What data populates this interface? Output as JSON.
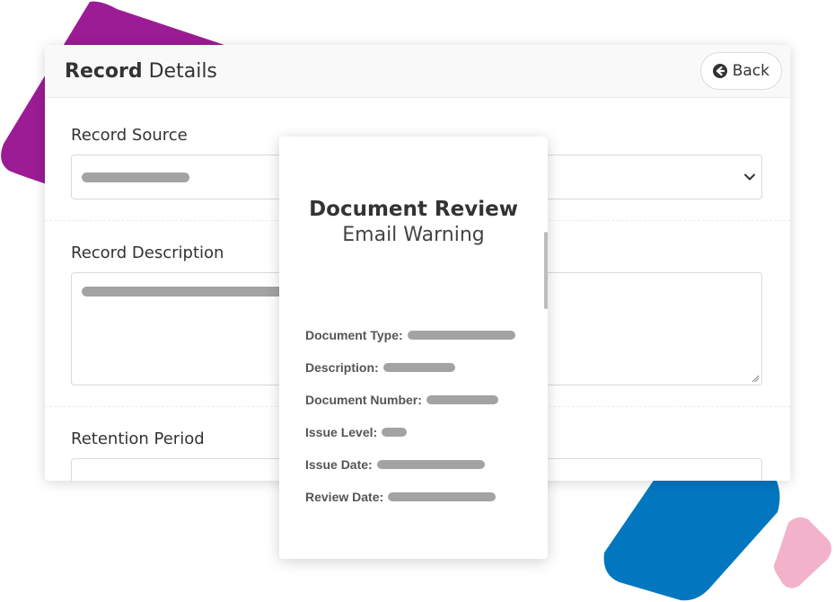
{
  "record_panel": {
    "title_bold": "Record",
    "title_rest": " Details",
    "back_label": "Back",
    "fields": {
      "source_label": "Record Source",
      "description_label": "Record Description",
      "retention_label": "Retention Period"
    }
  },
  "document_card": {
    "title": "Document Review",
    "subtitle": "Email Warning",
    "rows": [
      {
        "label": "Document Type:"
      },
      {
        "label": "Description:"
      },
      {
        "label": "Document Number:"
      },
      {
        "label": "Issue Level:"
      },
      {
        "label": "Issue Date:"
      },
      {
        "label": "Review Date:"
      }
    ]
  },
  "colors": {
    "accent_purple": "#9b1c94",
    "accent_blue": "#0277c0",
    "accent_pink": "#f2b3ca",
    "placeholder_gray": "#a3a3a3"
  },
  "icons": {
    "back": "circle-arrow-left-icon",
    "dropdown": "chevron-down-icon",
    "resize": "resize-handle-icon"
  }
}
